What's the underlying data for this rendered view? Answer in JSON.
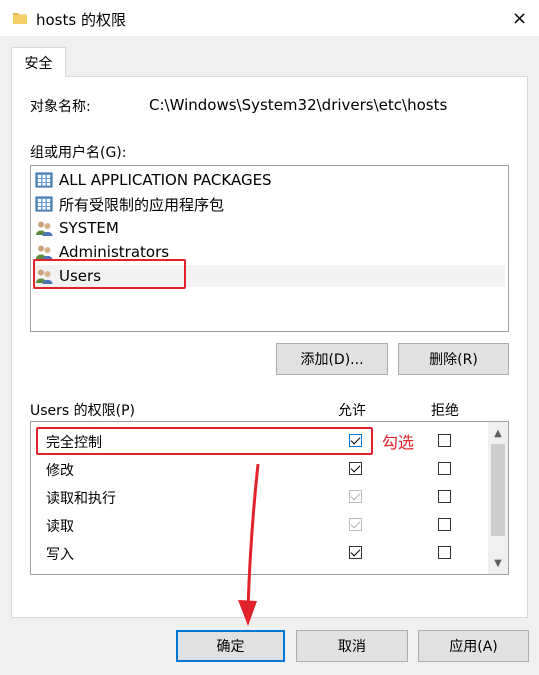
{
  "window": {
    "title": "hosts 的权限",
    "close_icon": "×"
  },
  "tab": {
    "label": "安全"
  },
  "object": {
    "label": "对象名称:",
    "value": "C:\\Windows\\System32\\drivers\\etc\\hosts"
  },
  "groups": {
    "label": "组或用户名(G):",
    "items": [
      {
        "label": "ALL APPLICATION PACKAGES",
        "icon": "package-group-icon"
      },
      {
        "label": "所有受限制的应用程序包",
        "icon": "package-group-icon"
      },
      {
        "label": "SYSTEM",
        "icon": "user-group-icon"
      },
      {
        "label": "Administrators",
        "icon": "user-group-icon"
      },
      {
        "label": "Users",
        "icon": "user-group-icon",
        "selected": true
      }
    ]
  },
  "buttons": {
    "add": "添加(D)...",
    "remove": "删除(R)",
    "ok": "确定",
    "cancel": "取消",
    "apply": "应用(A)"
  },
  "permissions": {
    "label": "Users 的权限(P)",
    "allow_header": "允许",
    "deny_header": "拒绝",
    "rows": [
      {
        "name": "完全控制",
        "allow": true,
        "allow_disabled": false,
        "deny": false
      },
      {
        "name": "修改",
        "allow": true,
        "allow_disabled": false,
        "deny": false
      },
      {
        "name": "读取和执行",
        "allow": true,
        "allow_disabled": true,
        "deny": false
      },
      {
        "name": "读取",
        "allow": true,
        "allow_disabled": true,
        "deny": false
      },
      {
        "name": "写入",
        "allow": true,
        "allow_disabled": false,
        "deny": false
      }
    ]
  },
  "annotation": {
    "text": "勾选",
    "color": "#e0232a"
  },
  "colors": {
    "accent": "#0078d7",
    "annotation": "#e0232a"
  }
}
